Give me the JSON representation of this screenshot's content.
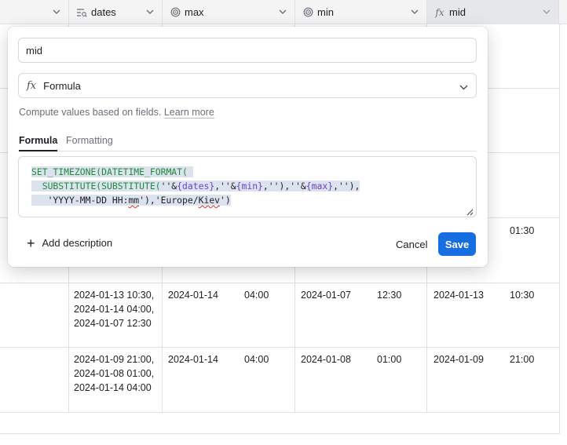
{
  "grid": {
    "columns": [
      {
        "name": "",
        "icon": ""
      },
      {
        "name": "dates",
        "icon": "lookup-formula-icon"
      },
      {
        "name": "max",
        "icon": "rollup-icon"
      },
      {
        "name": "min",
        "icon": "rollup-icon"
      },
      {
        "name": "mid",
        "icon": "formula-icon"
      }
    ],
    "rows": [
      {
        "mid_time": "01:30"
      },
      {
        "dates_lines": [
          "2024-01-13 10:30,",
          "2024-01-14 04:00,",
          "2024-01-07 12:30"
        ],
        "max_date": "2024-01-14",
        "max_time": "04:00",
        "min_date": "2024-01-07",
        "min_time": "12:30",
        "mid_date": "2024-01-13",
        "mid_time": "10:30"
      },
      {
        "dates_lines": [
          "2024-01-09 21:00,",
          "2024-01-08 01:00,",
          "2024-01-14 04:00"
        ],
        "max_date": "2024-01-14",
        "max_time": "04:00",
        "min_date": "2024-01-08",
        "min_time": "01:00",
        "mid_date": "2024-01-09",
        "mid_time": "21:00"
      }
    ]
  },
  "popover": {
    "field_name": "mid",
    "field_type": "Formula",
    "description_text": "Compute values based on fields.",
    "learn_more": "Learn more",
    "tabs": [
      "Formula",
      "Formatting"
    ],
    "formula_lines": [
      "SET_TIMEZONE(DATETIME_FORMAT(",
      "SUBSTITUTE(SUBSTITUTE(''&{dates},''&{min},''),''&{max},''),",
      "'YYYY-MM-DD HH:mm'),'Europe/Kiev')"
    ],
    "add_description": "Add description",
    "cancel": "Cancel",
    "save": "Save"
  },
  "colors": {
    "accent": "#166ee1",
    "function": "#1f8a3a",
    "field": "#6d3fd4",
    "selection": "#dce3ee"
  }
}
